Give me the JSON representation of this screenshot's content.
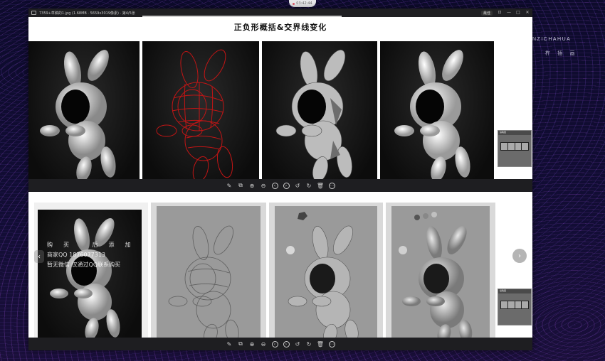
{
  "window": {
    "title": "7359+草稿的1.jpg (1.68MB · 5659x3019像素) · 第4/5张",
    "pin_label": "最佳",
    "controls": [
      "⊡",
      "—",
      "□",
      "✕"
    ]
  },
  "top_notch": {
    "label": "03:42:44"
  },
  "brand": {
    "name": "NZICHAHUA",
    "subtitle": "杵 插 画"
  },
  "upper_image": {
    "heading": "正负形概括&交界线变化",
    "panels": [
      "shaded-render",
      "red-wireframe",
      "plane-break-render",
      "final-render"
    ]
  },
  "toolbar": {
    "buttons": [
      {
        "name": "edit",
        "glyph": "✎"
      },
      {
        "name": "crop",
        "glyph": "⧉"
      },
      {
        "name": "zoom-in",
        "glyph": "⊕"
      },
      {
        "name": "zoom-out",
        "glyph": "⊖"
      },
      {
        "name": "prev",
        "glyph": "‹"
      },
      {
        "name": "next",
        "glyph": "›"
      },
      {
        "name": "rotate-left",
        "glyph": "↺"
      },
      {
        "name": "rotate-right",
        "glyph": "↻"
      },
      {
        "name": "delete",
        "glyph": "🗑"
      },
      {
        "name": "more",
        "glyph": "⋯"
      }
    ]
  },
  "watermark": {
    "line1": "购买 后添加",
    "line2": "商家QQ 1876077313",
    "line3": "暂无微信 仅通过QQ联系购买"
  },
  "nav": {
    "next_glyph": "›",
    "prev_glyph": "‹"
  },
  "thumbnail_popup": {
    "title": "缩略图"
  }
}
